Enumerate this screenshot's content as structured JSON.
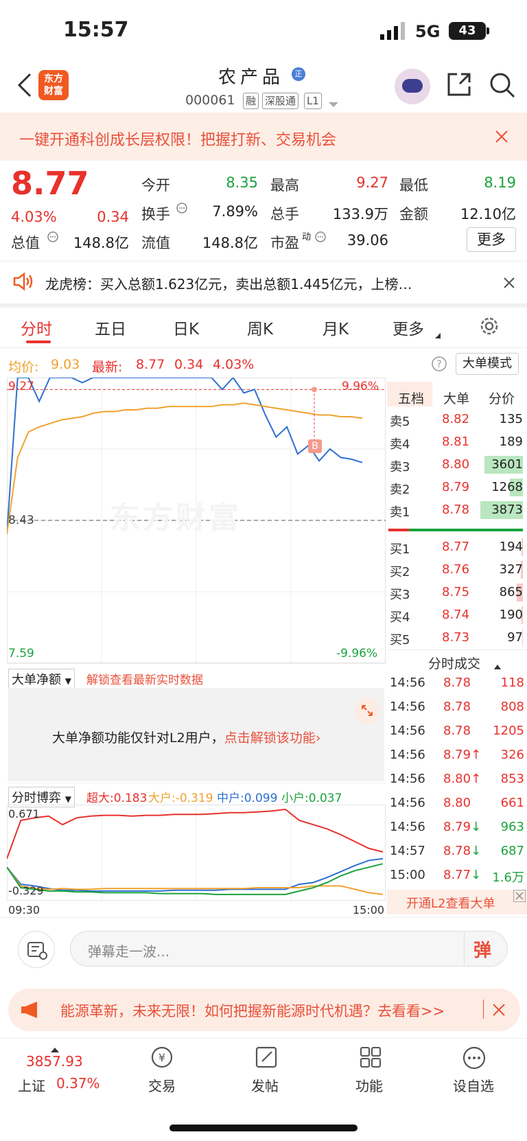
{
  "status": {
    "time": "15:57",
    "network": "5G",
    "battery": "43"
  },
  "header": {
    "logo_line1": "东方",
    "logo_line2": "财富",
    "stock_name": "农产品",
    "badge": "正",
    "code": "000061",
    "tags": [
      "融",
      "深股通",
      "L1"
    ]
  },
  "promo": {
    "text": "一键开通科创成长层权限！把握打新、交易机会"
  },
  "quote": {
    "price": "8.77",
    "change_pct": "4.03%",
    "change": "0.34",
    "open_label": "今开",
    "open": "8.35",
    "high_label": "最高",
    "high": "9.27",
    "low_label": "最低",
    "low": "8.19",
    "turnover_label": "换手",
    "turnover": "7.89%",
    "volume_label": "总手",
    "volume": "133.9万",
    "amount_label": "金额",
    "amount": "12.10亿",
    "mktcap_label": "总值",
    "mktcap": "148.8亿",
    "float_label": "流值",
    "float": "148.8亿",
    "pe_label": "市盈",
    "pe_sup": "动",
    "pe": "39.06",
    "more": "更多"
  },
  "notice": {
    "text": "龙虎榜：买入总额1.623亿元，卖出总额1.445亿元，上榜…"
  },
  "tabs": [
    "分时",
    "五日",
    "日K",
    "周K",
    "月K",
    "更多"
  ],
  "chart_info": {
    "avg_label": "均价:",
    "avg": "9.03",
    "last_label": "最新:",
    "last": "8.77",
    "chg": "0.34",
    "chg_pct": "4.03%",
    "big_mode": "大单模式"
  },
  "chart_data": {
    "type": "line",
    "y_ticks_left": [
      "9.27",
      "8.43",
      "7.59"
    ],
    "y_ticks_right": [
      "9.96%",
      "-9.96%"
    ],
    "x_ticks": [
      "09:30",
      "15:00"
    ],
    "ylim": [
      7.59,
      9.27
    ],
    "prev_close": 8.43,
    "marker": "B",
    "watermark": "东方财富",
    "series": [
      {
        "color": "#2f6fd0",
        "values": [
          8.35,
          9.27,
          9.27,
          9.13,
          9.27,
          9.27,
          9.27,
          9.24,
          9.27,
          9.27,
          9.27,
          9.27,
          9.27,
          9.27,
          9.27,
          9.27,
          9.27,
          9.27,
          9.27,
          9.27,
          9.2,
          9.27,
          9.18,
          9.2,
          9.05,
          8.92,
          8.98,
          8.82,
          8.87,
          8.78,
          8.85,
          8.8,
          8.79,
          8.77
        ]
      },
      {
        "color": "#f0a22e",
        "values": [
          8.35,
          8.8,
          8.95,
          8.98,
          9.0,
          9.02,
          9.03,
          9.04,
          9.06,
          9.07,
          9.07,
          9.08,
          9.08,
          9.09,
          9.09,
          9.1,
          9.1,
          9.1,
          9.1,
          9.1,
          9.11,
          9.11,
          9.12,
          9.11,
          9.1,
          9.09,
          9.08,
          9.07,
          9.06,
          9.05,
          9.05,
          9.04,
          9.04,
          9.03
        ]
      }
    ]
  },
  "orderbook": {
    "tabs": [
      "五档",
      "大单",
      "分价"
    ],
    "asks": [
      {
        "label": "卖5",
        "price": "8.82",
        "vol": "135",
        "ratio": 0.0
      },
      {
        "label": "卖4",
        "price": "8.81",
        "vol": "189",
        "ratio": 0.0
      },
      {
        "label": "卖3",
        "price": "8.80",
        "vol": "3601",
        "ratio": 0.9
      },
      {
        "label": "卖2",
        "price": "8.79",
        "vol": "1268",
        "ratio": 0.3
      },
      {
        "label": "卖1",
        "price": "8.78",
        "vol": "3873",
        "ratio": 1.0
      }
    ],
    "bids": [
      {
        "label": "买1",
        "price": "8.77",
        "vol": "194",
        "ratio": 0.03
      },
      {
        "label": "买2",
        "price": "8.76",
        "vol": "327",
        "ratio": 0.05
      },
      {
        "label": "买3",
        "price": "8.75",
        "vol": "865",
        "ratio": 0.15
      },
      {
        "label": "买4",
        "price": "8.74",
        "vol": "190",
        "ratio": 0.03
      },
      {
        "label": "买5",
        "price": "8.73",
        "vol": "97",
        "ratio": 0.02
      }
    ]
  },
  "trades": {
    "title": "分时成交",
    "rows": [
      {
        "time": "14:56",
        "price": "8.78",
        "arrow": "",
        "vol": "118",
        "dir": "up"
      },
      {
        "time": "14:56",
        "price": "8.78",
        "arrow": "",
        "vol": "808",
        "dir": "up"
      },
      {
        "time": "14:56",
        "price": "8.78",
        "arrow": "",
        "vol": "1205",
        "dir": "up"
      },
      {
        "time": "14:56",
        "price": "8.79",
        "arrow": "↑",
        "vol": "326",
        "dir": "up"
      },
      {
        "time": "14:56",
        "price": "8.80",
        "arrow": "↑",
        "vol": "853",
        "dir": "up"
      },
      {
        "time": "14:56",
        "price": "8.80",
        "arrow": "",
        "vol": "661",
        "dir": "up"
      },
      {
        "time": "14:56",
        "price": "8.79",
        "arrow": "↓",
        "vol": "963",
        "dir": "down"
      },
      {
        "time": "14:57",
        "price": "8.78",
        "arrow": "↓",
        "vol": "687",
        "dir": "down"
      },
      {
        "time": "15:00",
        "price": "8.77",
        "arrow": "↓",
        "vol": "1.6万",
        "dir": "down"
      }
    ],
    "l2_link": "开通L2查看大单"
  },
  "net_volume": {
    "title": "大单净额",
    "unlock_hint": "解锁查看最新实时数据",
    "lock_text": "大单净额功能仅针对L2用户，",
    "lock_link": "点击解锁该功能"
  },
  "game": {
    "title": "分时博弈",
    "super_label": "超大:0.183",
    "large_label": "大户:-0.319",
    "mid_label": "中户:0.099",
    "small_label": "小户:0.037",
    "y_top": "0.671",
    "y_bottom": "-0.329",
    "x_start": "09:30",
    "x_end": "15:00"
  },
  "comment": {
    "placeholder": "弹幕走一波...",
    "dan": "弹"
  },
  "energy": {
    "text": "能源革新，未来无限！如何把握新能源时代机遇？去看看>>"
  },
  "bottom_nav": {
    "index_value": "3857.93",
    "index_name": "上证",
    "index_change": "0.37%",
    "items": [
      "交易",
      "发帖",
      "功能",
      "设自选"
    ]
  }
}
